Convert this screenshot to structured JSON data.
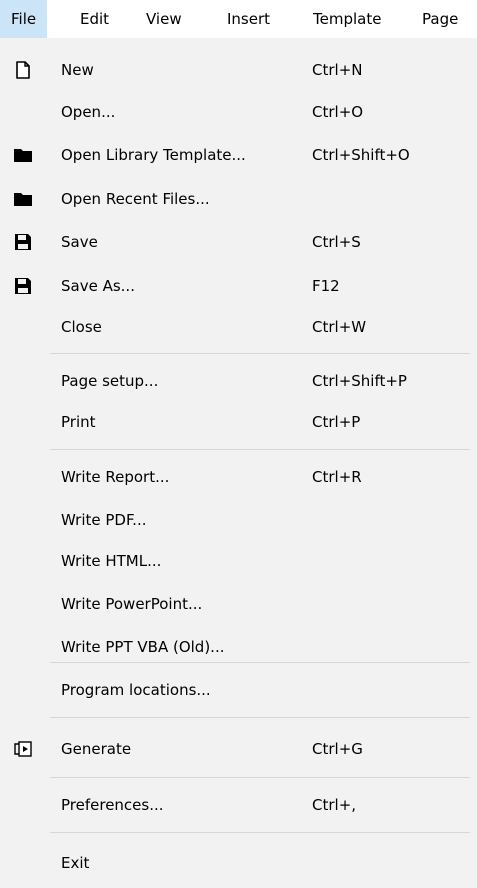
{
  "menubar": {
    "items": [
      {
        "label": "File"
      },
      {
        "label": "Edit"
      },
      {
        "label": "View"
      },
      {
        "label": "Insert"
      },
      {
        "label": "Template"
      },
      {
        "label": "Page"
      }
    ]
  },
  "menu": {
    "items": [
      {
        "label": "New",
        "shortcut": "Ctrl+N",
        "icon": "new-document-icon"
      },
      {
        "label": "Open...",
        "shortcut": "Ctrl+O"
      },
      {
        "label": "Open Library Template...",
        "shortcut": "Ctrl+Shift+O",
        "icon": "folder-icon"
      },
      {
        "label": "Open Recent Files...",
        "icon": "folder-icon"
      },
      {
        "label": "Save",
        "shortcut": "Ctrl+S",
        "icon": "save-icon"
      },
      {
        "label": "Save As...",
        "shortcut": "F12",
        "icon": "save-icon"
      },
      {
        "label": "Close",
        "shortcut": "Ctrl+W"
      },
      {
        "label": "Page setup...",
        "shortcut": "Ctrl+Shift+P"
      },
      {
        "label": "Print",
        "shortcut": "Ctrl+P"
      },
      {
        "label": "Write Report...",
        "shortcut": "Ctrl+R"
      },
      {
        "label": "Write PDF..."
      },
      {
        "label": "Write HTML..."
      },
      {
        "label": "Write PowerPoint..."
      },
      {
        "label": "Write PPT VBA (Old)..."
      },
      {
        "label": "Program locations..."
      },
      {
        "label": "Generate",
        "shortcut": "Ctrl+G",
        "icon": "generate-icon"
      },
      {
        "label": "Preferences...",
        "shortcut": "Ctrl+,"
      },
      {
        "label": "Exit"
      }
    ]
  },
  "colors": {
    "menu_background": "#f2f2f2",
    "menubar_background": "#ffffff",
    "active_highlight": "#cce4f7",
    "separator": "#d7d7d7"
  }
}
